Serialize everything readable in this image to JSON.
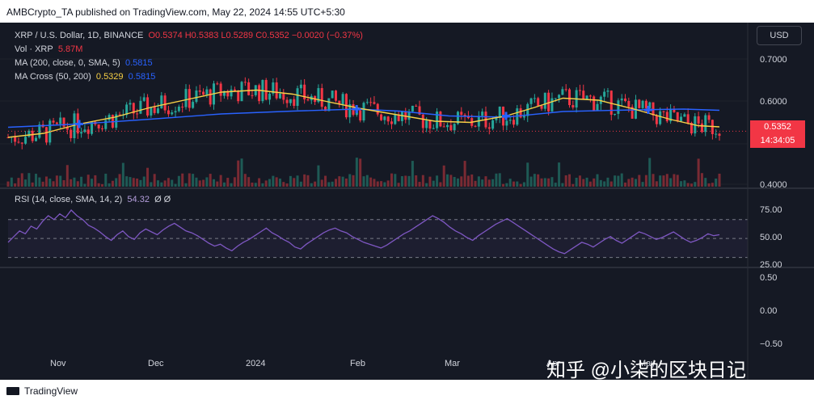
{
  "header": {
    "text": "AMBCrypto_TA published on TradingView.com, May 22, 2024 14:55 UTC+5:30"
  },
  "legend": {
    "symbol": "XRP / U.S. Dollar, 1D, BINANCE",
    "ohlc": "O0.5374 H0.5383 L0.5289 C0.5352 −0.0020 (−0.37%)",
    "vol_label": "Vol · XRP",
    "vol_value": "5.87M",
    "ma_label": "MA (200, close, 0, SMA, 5)",
    "ma_value": "0.5815",
    "macross_label": "MA Cross (50, 200)",
    "macross_v1": "0.5329",
    "macross_v2": "0.5815",
    "rsi_label": "RSI (14, close, SMA, 14, 2)",
    "rsi_value": "54.32",
    "rsi_extra": "Ø Ø"
  },
  "currency_button": "USD",
  "price_label": {
    "price": "0.5352",
    "time": "14:34:05"
  },
  "watermark": "知乎 @小柒的区块日记",
  "footer": {
    "logo": "TradingView"
  },
  "colors": {
    "up": "#26a69a",
    "down": "#f23645",
    "ma200": "#2962ff",
    "ma50": "#f7d046",
    "rsi": "#7e57c2",
    "background": "#151924"
  },
  "chart_data": [
    {
      "type": "line",
      "title": "XRP / U.S. Dollar, 1D, BINANCE",
      "x_tick_labels": [
        "Nov",
        "Dec",
        "2024",
        "Feb",
        "Mar",
        "Apr",
        "May"
      ],
      "y_tick_labels": [
        "0.7000",
        "0.6000",
        "0.4000"
      ],
      "ylim": [
        0.4,
        0.72
      ],
      "series": [
        {
          "name": "MA (200, close, 0, SMA, 5)",
          "points": [
            [
              0.0,
              0.545
            ],
            [
              0.1,
              0.553
            ],
            [
              0.2,
              0.565
            ],
            [
              0.3,
              0.578
            ],
            [
              0.4,
              0.585
            ],
            [
              0.49,
              0.59
            ],
            [
              0.55,
              0.585
            ],
            [
              0.62,
              0.573
            ],
            [
              0.7,
              0.57
            ],
            [
              0.78,
              0.584
            ],
            [
              0.88,
              0.588
            ],
            [
              0.95,
              0.59
            ],
            [
              1.0,
              0.587
            ]
          ]
        },
        {
          "name": "MA Cross (50, 200)",
          "points": [
            [
              0.0,
              0.52
            ],
            [
              0.05,
              0.53
            ],
            [
              0.1,
              0.553
            ],
            [
              0.15,
              0.57
            ],
            [
              0.2,
              0.594
            ],
            [
              0.25,
              0.613
            ],
            [
              0.3,
              0.632
            ],
            [
              0.35,
              0.637
            ],
            [
              0.4,
              0.627
            ],
            [
              0.45,
              0.608
            ],
            [
              0.5,
              0.59
            ],
            [
              0.55,
              0.575
            ],
            [
              0.6,
              0.56
            ],
            [
              0.65,
              0.557
            ],
            [
              0.7,
              0.573
            ],
            [
              0.74,
              0.594
            ],
            [
              0.78,
              0.617
            ],
            [
              0.83,
              0.612
            ],
            [
              0.88,
              0.59
            ],
            [
              0.93,
              0.565
            ],
            [
              0.97,
              0.549
            ],
            [
              1.0,
              0.546
            ]
          ]
        }
      ],
      "cross_markers": [
        [
          0.1,
          0.553
        ],
        [
          0.49,
          0.59
        ],
        [
          0.7,
          0.573
        ],
        [
          0.9,
          0.588
        ]
      ],
      "current_price": 0.5352
    },
    {
      "type": "line",
      "title": "RSI (14, close, SMA, 14, 2)",
      "y_tick_labels": [
        "75.00",
        "50.00",
        "25.00"
      ],
      "ylim": [
        22,
        80
      ],
      "bands": [
        70,
        50,
        30
      ],
      "series": [
        {
          "name": "RSI",
          "values": [
            46,
            52,
            58,
            55,
            63,
            60,
            68,
            74,
            70,
            76,
            72,
            80,
            74,
            70,
            64,
            61,
            57,
            52,
            48,
            54,
            58,
            52,
            49,
            56,
            60,
            57,
            54,
            59,
            63,
            66,
            62,
            58,
            56,
            53,
            49,
            45,
            42,
            44,
            40,
            37,
            42,
            46,
            49,
            53,
            57,
            61,
            56,
            53,
            49,
            46,
            41,
            39,
            44,
            48,
            52,
            56,
            59,
            61,
            58,
            56,
            52,
            49,
            46,
            44,
            42,
            40,
            43,
            47,
            51,
            55,
            58,
            62,
            66,
            70,
            74,
            71,
            67,
            62,
            58,
            55,
            51,
            48,
            53,
            57,
            61,
            65,
            68,
            71,
            67,
            63,
            59,
            55,
            51,
            47,
            43,
            39,
            36,
            34,
            38,
            42,
            46,
            44,
            41,
            45,
            49,
            52,
            48,
            45,
            49,
            53,
            57,
            55,
            52,
            49,
            51,
            54,
            57,
            53,
            49,
            46,
            48,
            51,
            55,
            53,
            54
          ]
        }
      ]
    },
    {
      "type": "line",
      "y_tick_labels": [
        "0.50",
        "0.00",
        "−0.50"
      ],
      "ylim": [
        -0.55,
        0.55
      ]
    }
  ]
}
